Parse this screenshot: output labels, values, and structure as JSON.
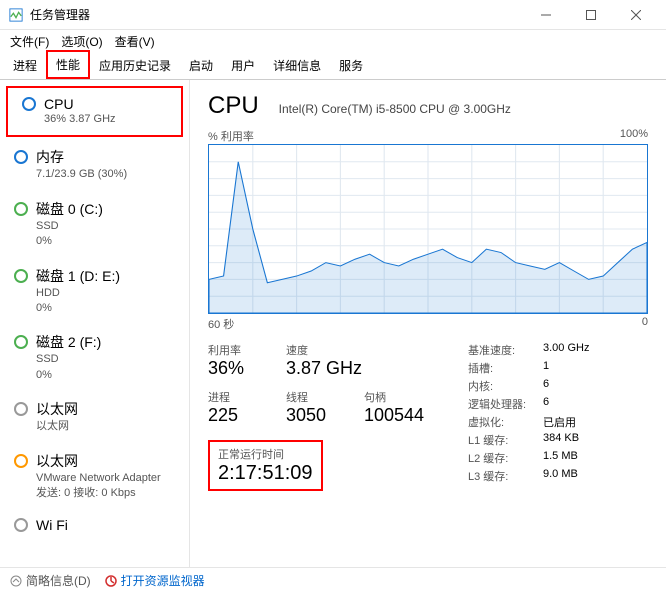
{
  "window": {
    "title": "任务管理器"
  },
  "menu": {
    "file": "文件(F)",
    "options": "选项(O)",
    "view": "查看(V)"
  },
  "tabs": [
    "进程",
    "性能",
    "应用历史记录",
    "启动",
    "用户",
    "详细信息",
    "服务"
  ],
  "sidebar": [
    {
      "title": "CPU",
      "sub": "36% 3.87 GHz",
      "ring": "blue"
    },
    {
      "title": "内存",
      "sub": "7.1/23.9 GB (30%)",
      "ring": "blue"
    },
    {
      "title": "磁盘 0 (C:)",
      "sub": "SSD",
      "sub2": "0%",
      "ring": "green"
    },
    {
      "title": "磁盘 1 (D: E:)",
      "sub": "HDD",
      "sub2": "0%",
      "ring": "green"
    },
    {
      "title": "磁盘 2 (F:)",
      "sub": "SSD",
      "sub2": "0%",
      "ring": "green"
    },
    {
      "title": "以太网",
      "sub": "以太网",
      "ring": "gray"
    },
    {
      "title": "以太网",
      "sub": "VMware Network Adapter",
      "sub2": "发送: 0 接收: 0 Kbps",
      "ring": "orange"
    },
    {
      "title": "Wi Fi",
      "sub": "",
      "ring": "gray"
    }
  ],
  "main": {
    "title": "CPU",
    "model": "Intel(R) Core(TM) i5-8500 CPU @ 3.00GHz",
    "chart_ylabel": "% 利用率",
    "chart_ymax": "100%",
    "chart_xlabel": "60 秒",
    "chart_xright": "0",
    "stats": {
      "util_label": "利用率",
      "util": "36%",
      "speed_label": "速度",
      "speed": "3.87 GHz",
      "proc_label": "进程",
      "proc": "225",
      "thread_label": "线程",
      "thread": "3050",
      "handle_label": "句柄",
      "handle": "100544",
      "uptime_label": "正常运行时间",
      "uptime": "2:17:51:09"
    },
    "specs": {
      "base_label": "基准速度:",
      "base": "3.00 GHz",
      "sockets_label": "插槽:",
      "sockets": "1",
      "cores_label": "内核:",
      "cores": "6",
      "lproc_label": "逻辑处理器:",
      "lproc": "6",
      "virt_label": "虚拟化:",
      "virt": "已启用",
      "l1_label": "L1 缓存:",
      "l1": "384 KB",
      "l2_label": "L2 缓存:",
      "l2": "1.5 MB",
      "l3_label": "L3 缓存:",
      "l3": "9.0 MB"
    }
  },
  "footer": {
    "brief": "简略信息(D)",
    "resmon": "打开资源监视器"
  },
  "chart_data": {
    "type": "area",
    "xlabel": "60 秒 → 0",
    "ylabel": "% 利用率",
    "ylim": [
      0,
      100
    ],
    "x_seconds": [
      60,
      58,
      56,
      54,
      52,
      50,
      48,
      46,
      44,
      42,
      40,
      38,
      36,
      34,
      32,
      30,
      28,
      26,
      24,
      22,
      20,
      18,
      16,
      14,
      12,
      10,
      8,
      6,
      4,
      2,
      0
    ],
    "values": [
      20,
      22,
      90,
      50,
      18,
      20,
      22,
      25,
      30,
      28,
      32,
      35,
      30,
      28,
      32,
      35,
      38,
      33,
      30,
      38,
      36,
      30,
      28,
      26,
      30,
      25,
      20,
      22,
      30,
      38,
      42
    ]
  }
}
